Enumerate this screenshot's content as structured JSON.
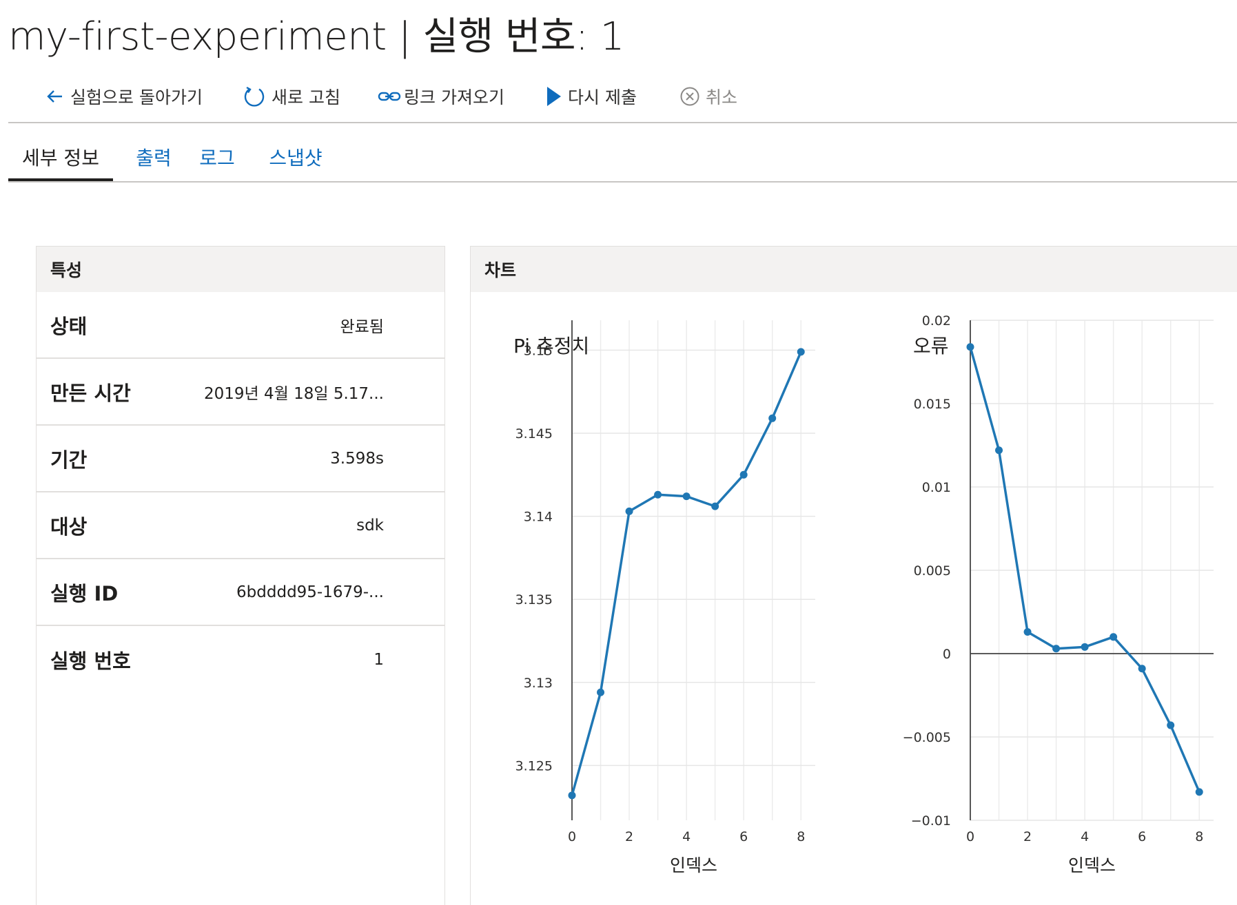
{
  "header": {
    "title": "my-first-experiment | 실행 번호: 1"
  },
  "toolbar": {
    "back_label": "실험으로 돌아가기",
    "refresh_label": "새로 고침",
    "link_label": "링크 가져오기",
    "resubmit_label": "다시 제출",
    "cancel_label": "취소",
    "icons": {
      "back": "arrow-left-icon",
      "refresh": "refresh-icon",
      "link": "link-icon",
      "resubmit": "play-icon",
      "cancel": "cancel-circle-icon"
    },
    "colors": {
      "accent": "#0f6cbd",
      "disabled": "#8a8886"
    }
  },
  "tabs": [
    {
      "label": "세부 정보",
      "active": true
    },
    {
      "label": "출력",
      "active": false
    },
    {
      "label": "로그",
      "active": false
    },
    {
      "label": "스냅샷",
      "active": false
    }
  ],
  "properties": {
    "header": "특성",
    "rows": [
      {
        "label": "상태",
        "value": "완료됨"
      },
      {
        "label": "만든 시간",
        "value": "2019년 4월 18일 5.17..."
      },
      {
        "label": "기간",
        "value": "3.598s"
      },
      {
        "label": "대상",
        "value": "sdk"
      },
      {
        "label": "실행 ID",
        "value": "6bdddd95-1679-..."
      },
      {
        "label": "실행 번호",
        "value": "1"
      }
    ]
  },
  "charts_panel": {
    "header": "차트"
  },
  "chart_data": [
    {
      "type": "line",
      "title": "Pi 추정치",
      "xlabel": "인덱스",
      "ylabel": "",
      "x": [
        0,
        1,
        2,
        3,
        4,
        5,
        6,
        7,
        8
      ],
      "series": [
        {
          "values": [
            3.1232,
            3.1294,
            3.1403,
            3.1413,
            3.1412,
            3.1406,
            3.1425,
            3.1459,
            3.1499
          ],
          "color": "#1f77b4"
        }
      ],
      "xlim": [
        0,
        8.5
      ],
      "ylim": [
        3.1217,
        3.1518
      ],
      "xticks": [
        0,
        2,
        4,
        6,
        8
      ],
      "xtick_labels": [
        "0",
        "2",
        "4",
        "6",
        "8"
      ],
      "yticks": [
        3.125,
        3.13,
        3.135,
        3.14,
        3.145,
        3.15
      ],
      "ytick_labels": [
        "3.125",
        "3.13",
        "3.135",
        "3.14",
        "3.145",
        "3.15"
      ],
      "grid": true
    },
    {
      "type": "line",
      "title": "오류",
      "xlabel": "인덱스",
      "ylabel": "",
      "x": [
        0,
        1,
        2,
        3,
        4,
        5,
        6,
        7,
        8
      ],
      "series": [
        {
          "values": [
            0.0184,
            0.0122,
            0.0013,
            0.0003,
            0.0004,
            0.001,
            -0.0009,
            -0.0043,
            -0.0083
          ],
          "color": "#1f77b4"
        }
      ],
      "xlim": [
        0,
        8.5
      ],
      "ylim": [
        -0.01,
        0.02
      ],
      "xticks": [
        0,
        2,
        4,
        6,
        8
      ],
      "xtick_labels": [
        "0",
        "2",
        "4",
        "6",
        "8"
      ],
      "yticks": [
        -0.01,
        -0.005,
        0,
        0.005,
        0.01,
        0.015,
        0.02
      ],
      "ytick_labels": [
        "−0.01",
        "−0.005",
        "0",
        "0.005",
        "0.01",
        "0.015",
        "0.02"
      ],
      "grid": true
    }
  ]
}
